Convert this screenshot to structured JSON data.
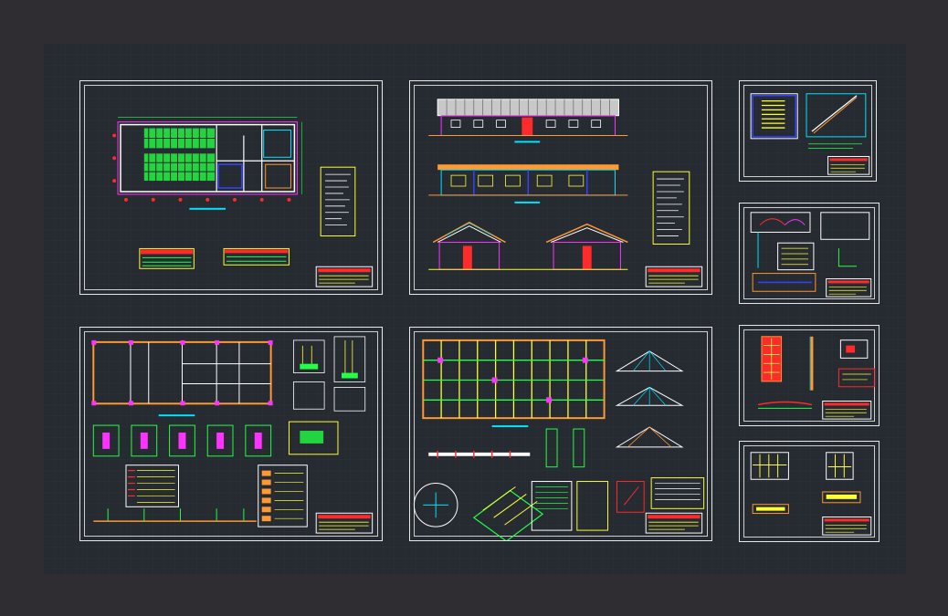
{
  "canvas": {
    "background": "#2f2c32",
    "workspace": "#262a31"
  },
  "colors": {
    "frame": "#e9e9e9",
    "wall": "#ffffff",
    "cyan": "#00e5ff",
    "yellow": "#ffff33",
    "green": "#22ff44",
    "red": "#ff2a2a",
    "magenta": "#ff33ff",
    "blue": "#3344ff",
    "orange": "#ff9933"
  },
  "sheets": [
    {
      "id": "floor-plan-sheet",
      "label": ""
    },
    {
      "id": "elevations-sections-sheet",
      "label": ""
    },
    {
      "id": "stair-detail-sheet",
      "label": ""
    },
    {
      "id": "sanitary-detail-sheet",
      "label": ""
    },
    {
      "id": "foundation-plan-sheet",
      "label": ""
    },
    {
      "id": "roof-structure-sheet",
      "label": ""
    },
    {
      "id": "door-detail-sheet",
      "label": ""
    },
    {
      "id": "window-detail-sheet",
      "label": ""
    }
  ]
}
